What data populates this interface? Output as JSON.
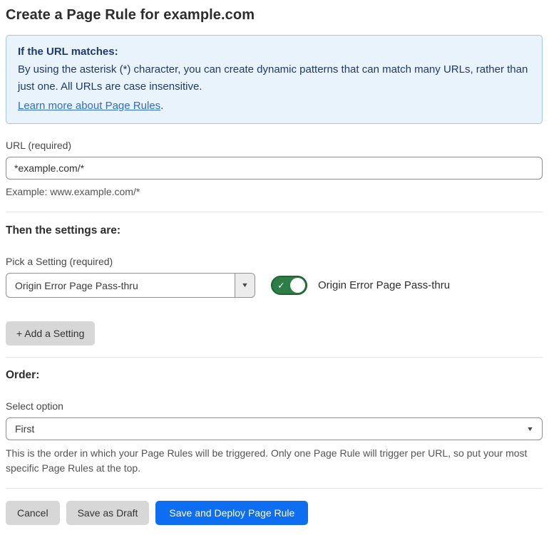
{
  "page": {
    "title": "Create a Page Rule for example.com"
  },
  "info_box": {
    "heading": "If the URL matches:",
    "body": "By using the asterisk (*) character, you can create dynamic patterns that can match many URLs, rather than just one. All URLs are case insensitive.",
    "link_label": "Learn more about Page Rules",
    "link_suffix": "."
  },
  "url_field": {
    "label": "URL (required)",
    "value": "*example.com/*",
    "helper": "Example: www.example.com/*"
  },
  "settings_section": {
    "heading": "Then the settings are:",
    "picker_label": "Pick a Setting (required)",
    "selected_setting": "Origin Error Page Pass-thru",
    "toggle_label": "Origin Error Page Pass-thru",
    "toggle_state": "on",
    "add_button_label": "+ Add a Setting"
  },
  "order_section": {
    "heading": "Order:",
    "select_label": "Select option",
    "selected_option": "First",
    "helper": "This is the order in which your Page Rules will be triggered. Only one Page Rule will trigger per URL, so put your most specific Page Rules at the top."
  },
  "actions": {
    "cancel_label": "Cancel",
    "save_draft_label": "Save as Draft",
    "save_deploy_label": "Save and Deploy Page Rule"
  },
  "icons": {
    "dropdown_arrow": "▼",
    "toggle_check": "✓"
  },
  "colors": {
    "info_bg": "#e9f3fb",
    "info_border": "#a3c7e8",
    "info_text": "#1e3a6d",
    "link": "#2c6cd6",
    "toggle_on": "#2d7e46",
    "primary_button": "#0d6ef2",
    "secondary_button": "#d7d7d7"
  }
}
